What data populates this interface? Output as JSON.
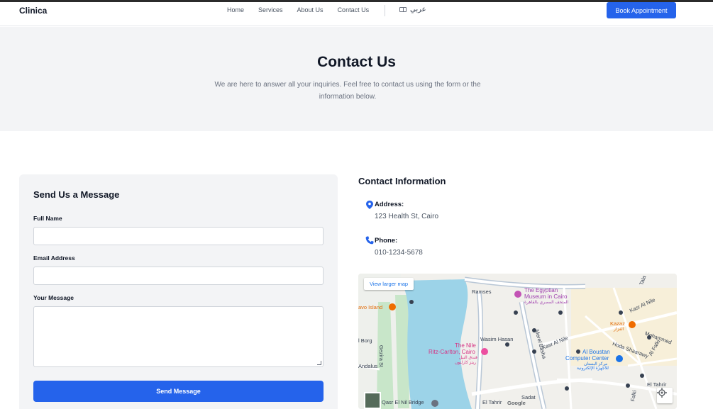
{
  "header": {
    "brand": "Clinica",
    "nav": [
      "Home",
      "Services",
      "About Us",
      "Contact Us"
    ],
    "lang_label": "عربي",
    "book_label": "Book Appointment"
  },
  "hero": {
    "title": "Contact Us",
    "subtitle": "We are here to answer all your inquiries. Feel free to contact us using the form or the information below."
  },
  "form": {
    "title": "Send Us a Message",
    "full_name_label": "Full Name",
    "email_label": "Email Address",
    "message_label": "Your Message",
    "send_label": "Send Message"
  },
  "contact": {
    "title": "Contact Information",
    "address_label": "Address:",
    "address_value": "123 Health St, Cairo",
    "phone_label": "Phone:",
    "phone_value": "010-1234-5678"
  },
  "map": {
    "link_label": "View larger map",
    "labels": {
      "ramses": "Ramses",
      "museum1": "The Egyptian",
      "museum2": "Museum in Cairo",
      "museum_ar": "المتحف المصري بالقاهرة",
      "island": "avo Island",
      "kasr_al_nile": "Kasr Al Nile",
      "kazaz": "Kazaz",
      "kazaz_ar": "الفزاز",
      "mohammed": "Mohammed",
      "wasim": "Wasim Hasan",
      "borg": "l Borg",
      "nile1": "The Nile",
      "nile2": "Ritz-Carlton, Cairo",
      "nile_ar1": "فندق النيل",
      "nile_ar2": "ريتز كارلتون",
      "merel": "Merel Basha",
      "kasr_al_nile2": "Kasr Al Nile",
      "hoda": "Hoda Shaarawy",
      "al_falki": "Al Falki",
      "boustan1": "Al Boustan",
      "boustan2": "Computer Center",
      "boustan_ar1": "مركز البستان",
      "boustan_ar2": "للأجهزة الإلكترونية",
      "gezira": "Gezira St",
      "andalus": "Andalus",
      "el_tahrir": "El Tahrir",
      "sadat": "Sadat",
      "el_tahrir2": "El Tahrir",
      "qasr_bridge": "Qasr El Nil Bridge",
      "google": "Google",
      "falki": "Falki",
      "tala": "Tala"
    }
  },
  "colors": {
    "accent": "#2563eb",
    "hero_bg": "#f3f4f6",
    "water": "#9cd3e8"
  }
}
